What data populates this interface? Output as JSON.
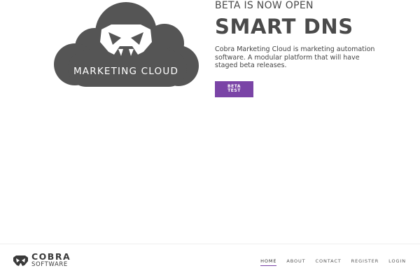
{
  "hero": {
    "logo": {
      "icon": "cobra-head-icon",
      "text": "MARKETING CLOUD"
    },
    "kicker": "BETA IS NOW OPEN",
    "headline": "SMART DNS",
    "description": "Cobra Marketing Cloud is marketing automation software. A modular platform that will have staged beta releases.",
    "cta_label": "BETA\nTEST"
  },
  "footer": {
    "brand": {
      "name": "COBRA",
      "sub": "SOFTWARE",
      "icon": "cobra-head-icon"
    },
    "nav": {
      "items": [
        {
          "label": "HOME",
          "active": true
        },
        {
          "label": "ABOUT",
          "active": false
        },
        {
          "label": "CONTACT",
          "active": false
        },
        {
          "label": "REGISTER",
          "active": false
        },
        {
          "label": "LOGIN",
          "active": false
        }
      ]
    }
  },
  "colors": {
    "accent": "#7a44a6",
    "cloud": "#555555",
    "text": "#4a4a4a"
  }
}
